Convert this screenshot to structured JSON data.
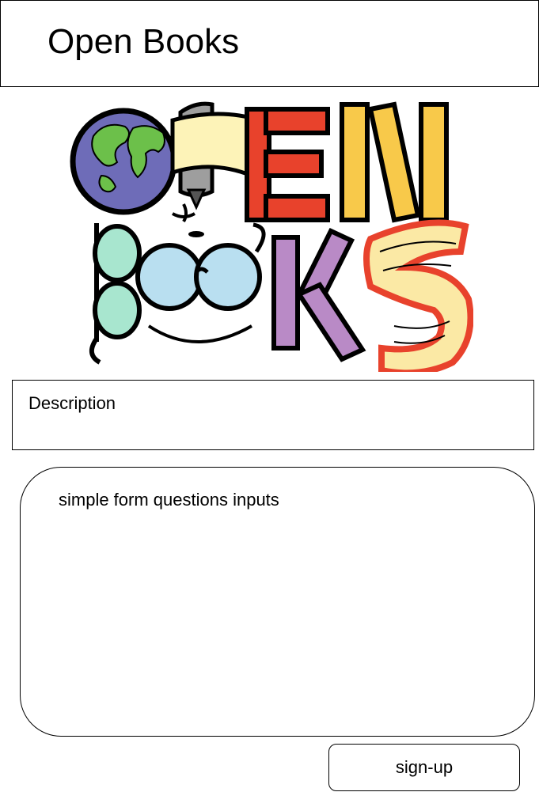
{
  "header": {
    "title": "Open Books"
  },
  "logo": {
    "row1_letters": "OPEN",
    "row2_letters": "BOOKS",
    "colors": {
      "globe_ocean": "#6e6cb8",
      "globe_land": "#6cc04a",
      "banner": "#fdf3b8",
      "book_red": "#e8422c",
      "book_yellow": "#f8c94a",
      "book_purple": "#b98ac6",
      "lens": "#b9dff0",
      "lens_green": "#a8e6cf",
      "open_book_pages": "#fbe9a5"
    }
  },
  "description": {
    "label": "Description"
  },
  "form": {
    "label": "simple form questions inputs"
  },
  "actions": {
    "signup_label": "sign-up"
  }
}
